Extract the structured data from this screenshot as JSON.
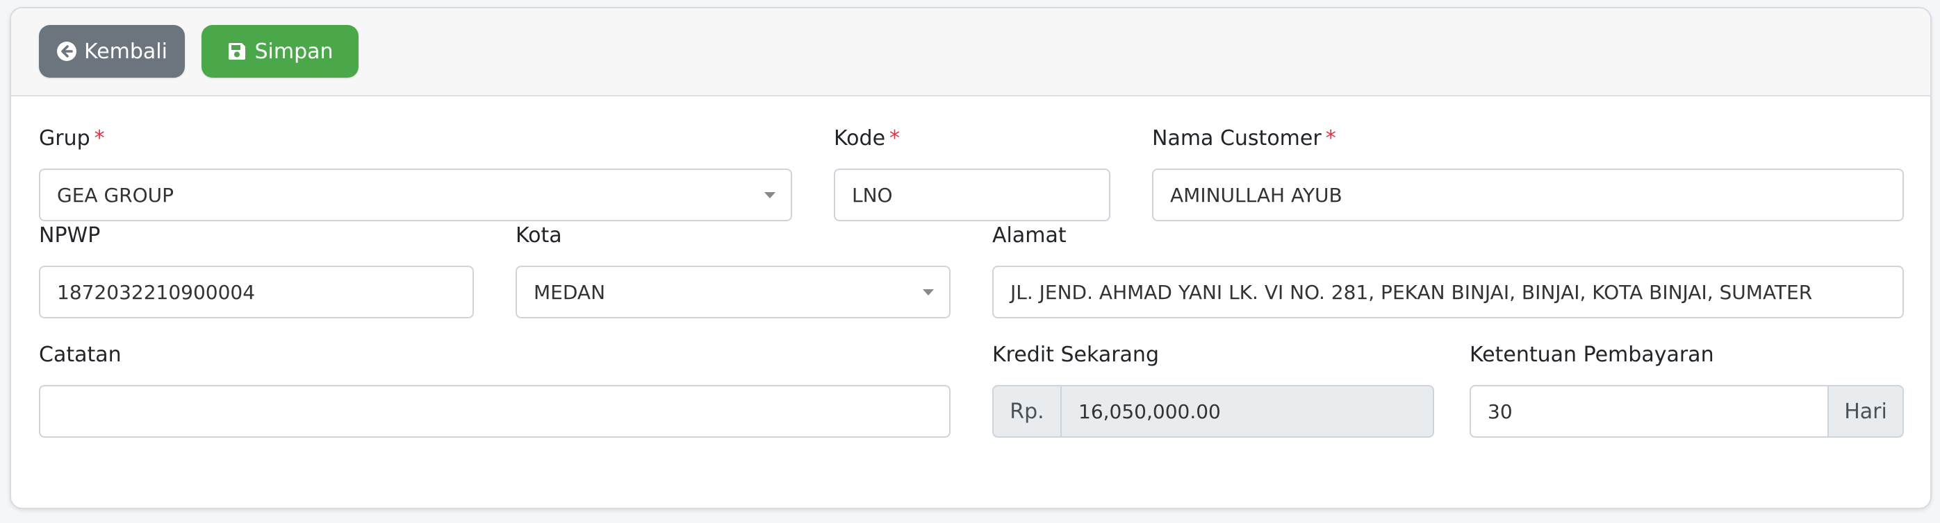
{
  "toolbar": {
    "back_label": "Kembali",
    "save_label": "Simpan"
  },
  "form": {
    "grup": {
      "label": "Grup",
      "required_mark": "*",
      "value": "GEA GROUP"
    },
    "kode": {
      "label": "Kode",
      "required_mark": "*",
      "value": "LNO"
    },
    "nama_customer": {
      "label": "Nama Customer",
      "required_mark": "*",
      "value": "AMINULLAH AYUB"
    },
    "npwp": {
      "label": "NPWP",
      "value": "1872032210900004"
    },
    "kota": {
      "label": "Kota",
      "value": "MEDAN"
    },
    "alamat": {
      "label": "Alamat",
      "value": "JL. JEND. AHMAD YANI LK. VI NO. 281, PEKAN BINJAI, BINJAI, KOTA BINJAI, SUMATER"
    },
    "catatan": {
      "label": "Catatan",
      "value": ""
    },
    "kredit_sekarang": {
      "label": "Kredit Sekarang",
      "prefix": "Rp.",
      "value": "16,050,000.00"
    },
    "ketentuan_pembayaran": {
      "label": "Ketentuan Pembayaran",
      "value": "30",
      "suffix": "Hari"
    }
  },
  "colors": {
    "back_button": "#6c757d",
    "save_button": "#4aa84a",
    "required": "#dc3545"
  },
  "icons": {
    "back": "arrow-circle-left-icon",
    "save": "floppy-disk-icon",
    "select": "caret-down-icon"
  }
}
